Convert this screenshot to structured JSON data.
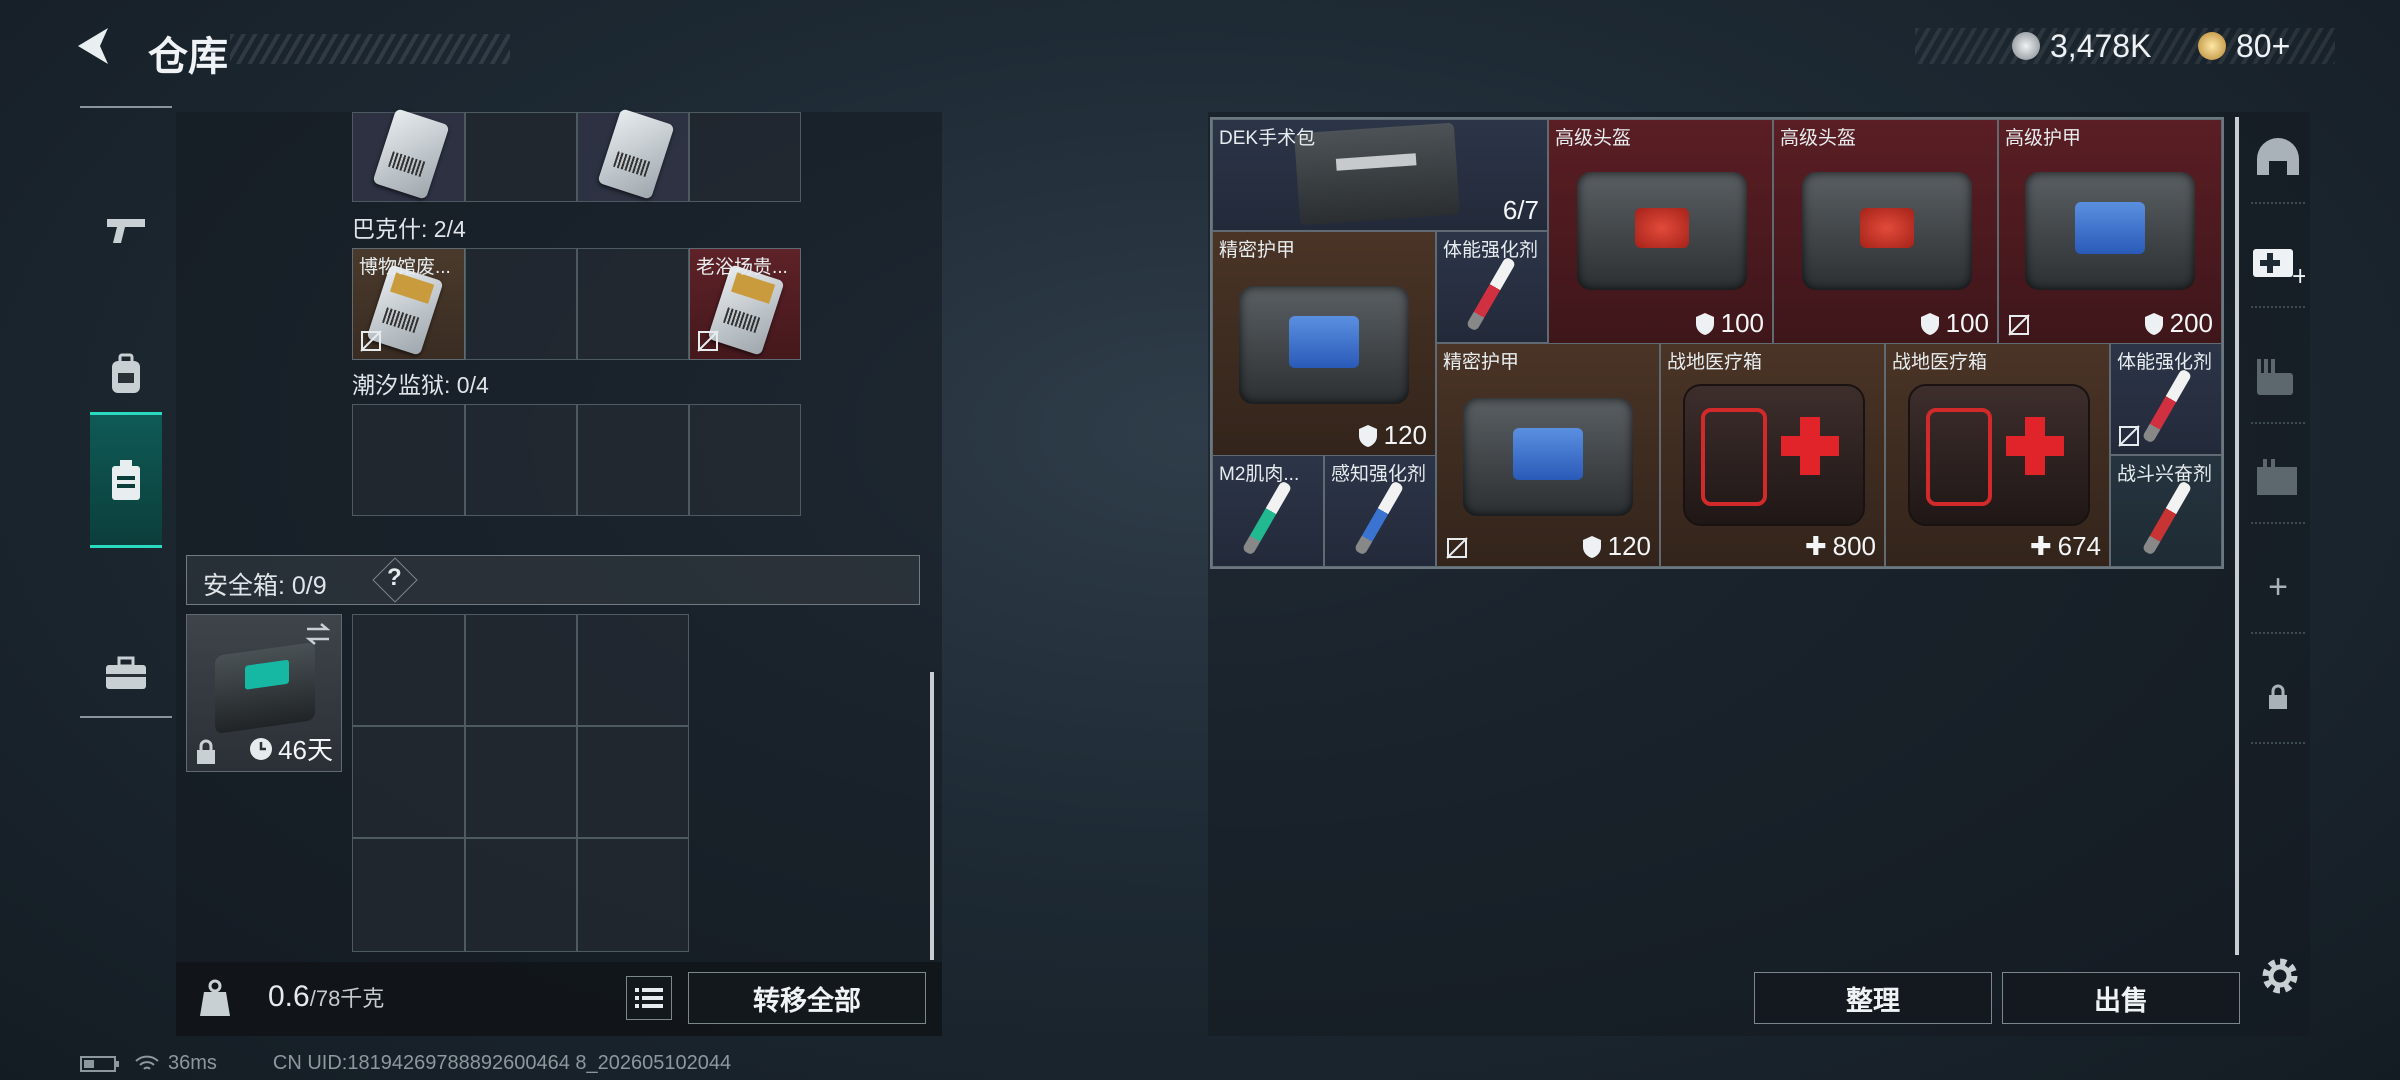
{
  "header": {
    "title": "仓库"
  },
  "currency": {
    "silver": "3,478K",
    "gold": "80+",
    "silver_color": "#c8ccd0",
    "gold_color": "#d8b46a"
  },
  "left_rail": {
    "items": [
      "weapon-icon",
      "backpack-icon",
      "safebox-icon",
      "briefcase-icon"
    ],
    "active_index": 2
  },
  "collections": [
    {
      "label": "巴克什: 2/4"
    },
    {
      "label": "潮汐监狱: 0/4"
    }
  ],
  "collection_items": [
    {
      "label": "博物馆废..."
    },
    {
      "label": "老浴场贵..."
    }
  ],
  "safe_box": {
    "label": "安全箱: 0/9",
    "help": "?",
    "duration": "46天"
  },
  "weight": {
    "current": "0.6",
    "capacity": "/78千克"
  },
  "buttons": {
    "transfer_all": "转移全部",
    "sort": "整理",
    "sell": "出售"
  },
  "inventory": [
    {
      "name": "DEK手术包",
      "value": "6/7",
      "bg": "blue"
    },
    {
      "name": "高级头盔",
      "value": "100",
      "bg": "red"
    },
    {
      "name": "高级头盔",
      "value": "100",
      "bg": "red"
    },
    {
      "name": "高级护甲",
      "value": "200",
      "bg": "red"
    },
    {
      "name": "精密护甲",
      "value": "120",
      "bg": "brown"
    },
    {
      "name": "体能强化剂",
      "value": "",
      "bg": "blue"
    },
    {
      "name": "精密护甲",
      "value": "120",
      "bg": "brown"
    },
    {
      "name": "战地医疗箱",
      "value": "800",
      "bg": "brown"
    },
    {
      "name": "战地医疗箱",
      "value": "674",
      "bg": "brown"
    },
    {
      "name": "体能强化剂",
      "value": "",
      "bg": "blue"
    },
    {
      "name": "M2肌肉...",
      "value": "",
      "bg": "blue"
    },
    {
      "name": "感知强化剂",
      "value": "",
      "bg": "blue"
    },
    {
      "name": "战斗兴奋剂",
      "value": "",
      "bg": "teal"
    }
  ],
  "footer": {
    "ping": "36ms",
    "uid": "CN UID:18194269788892600464 8_202605102044"
  }
}
